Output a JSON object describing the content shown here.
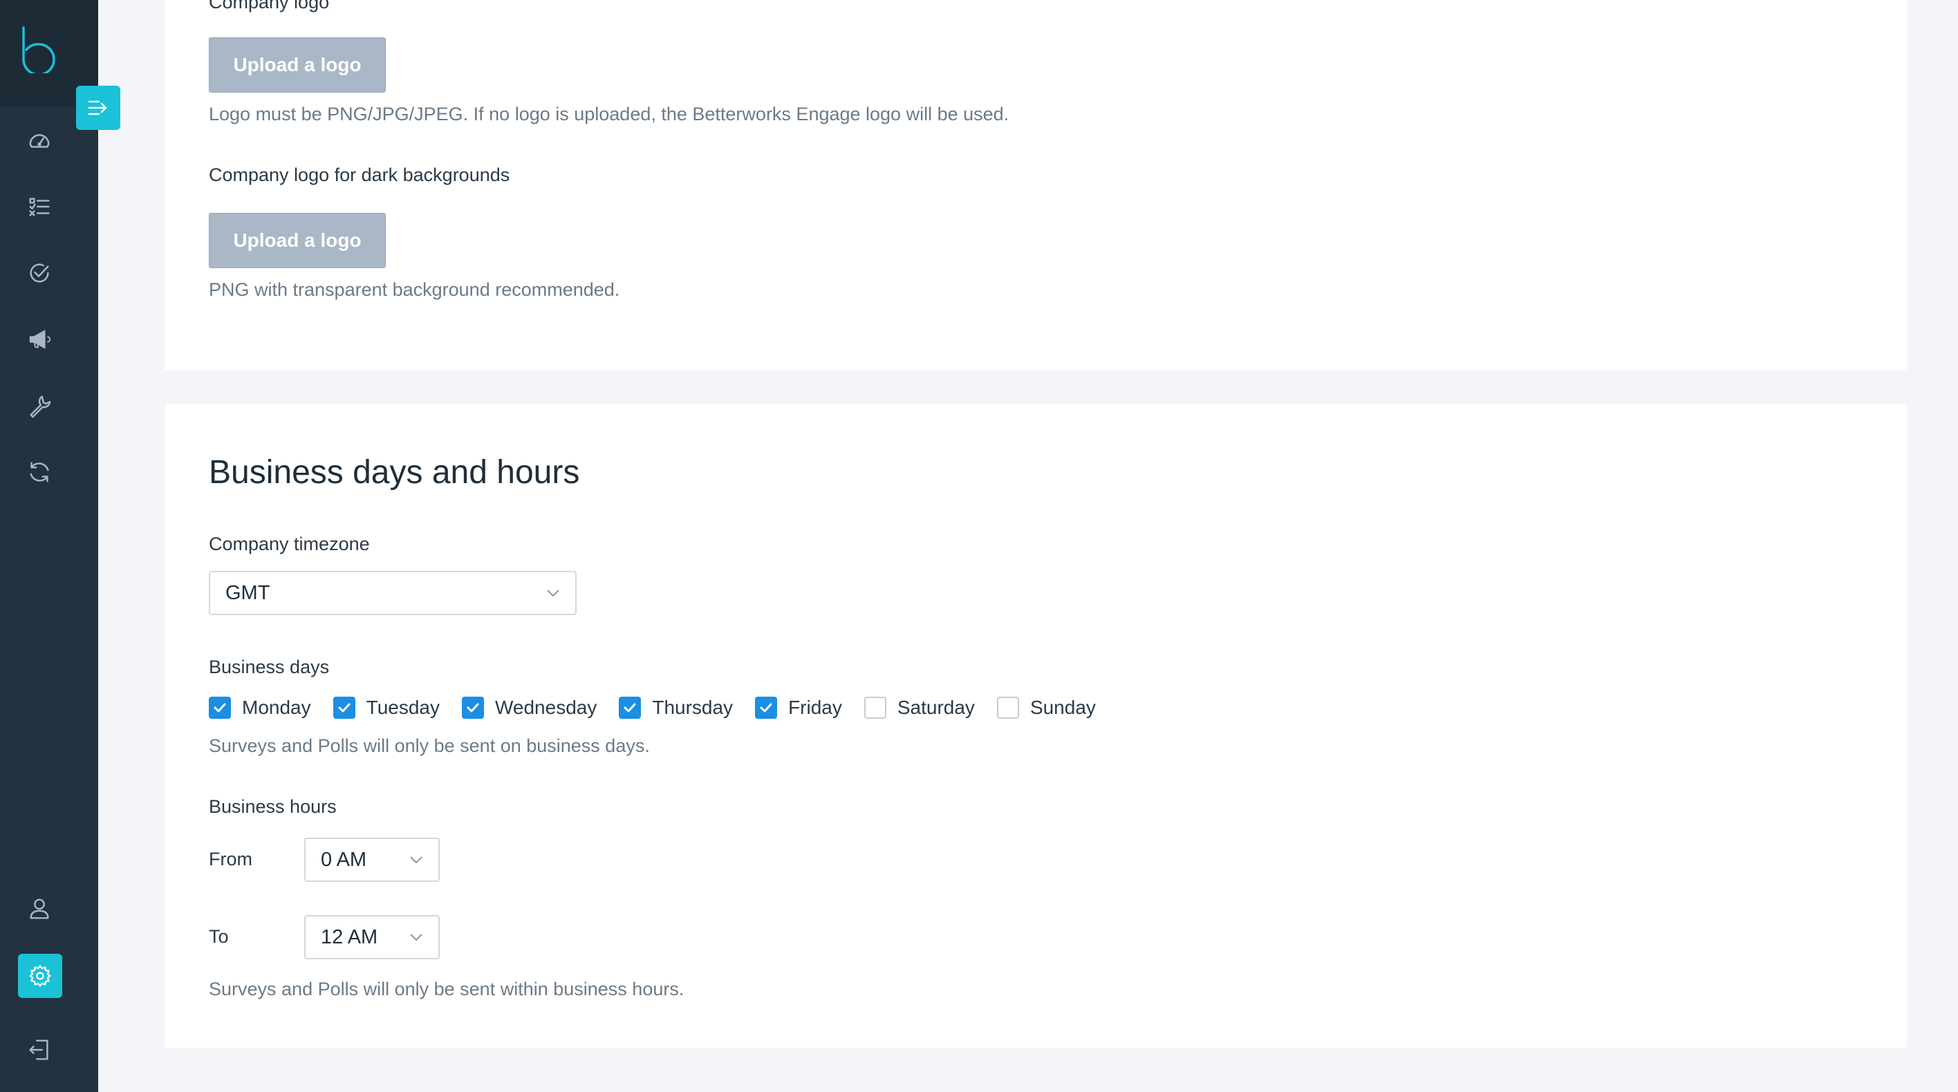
{
  "sidebar": {
    "icons": [
      "dashboard-icon",
      "checklist-icon",
      "check-circle-icon",
      "megaphone-icon",
      "wrench-icon",
      "sync-icon",
      "user-icon",
      "gear-icon",
      "logout-icon"
    ],
    "accent": "#1bc1d6",
    "background": "#22323f"
  },
  "logo_section": {
    "company_logo_label": "Company logo",
    "upload_label": "Upload a logo",
    "logo_hint": "Logo must be PNG/JPG/JPEG. If no logo is uploaded, the Betterworks Engage logo will be used.",
    "dark_logo_label": "Company logo for dark backgrounds",
    "dark_upload_label": "Upload a logo",
    "dark_logo_hint": "PNG with transparent background recommended."
  },
  "business": {
    "title": "Business days and hours",
    "timezone_label": "Company timezone",
    "timezone_value": "GMT",
    "days_label": "Business days",
    "days": [
      {
        "label": "Monday",
        "checked": true
      },
      {
        "label": "Tuesday",
        "checked": true
      },
      {
        "label": "Wednesday",
        "checked": true
      },
      {
        "label": "Thursday",
        "checked": true
      },
      {
        "label": "Friday",
        "checked": true
      },
      {
        "label": "Saturday",
        "checked": false
      },
      {
        "label": "Sunday",
        "checked": false
      }
    ],
    "days_hint": "Surveys and Polls will only be sent on business days.",
    "hours_label": "Business hours",
    "from_label": "From",
    "from_value": "0 AM",
    "to_label": "To",
    "to_value": "12 AM",
    "hours_hint": "Surveys and Polls will only be sent within business hours."
  },
  "colors": {
    "checkbox_checked": "#1a8fe3",
    "button_disabled": "#a9b7c6"
  }
}
